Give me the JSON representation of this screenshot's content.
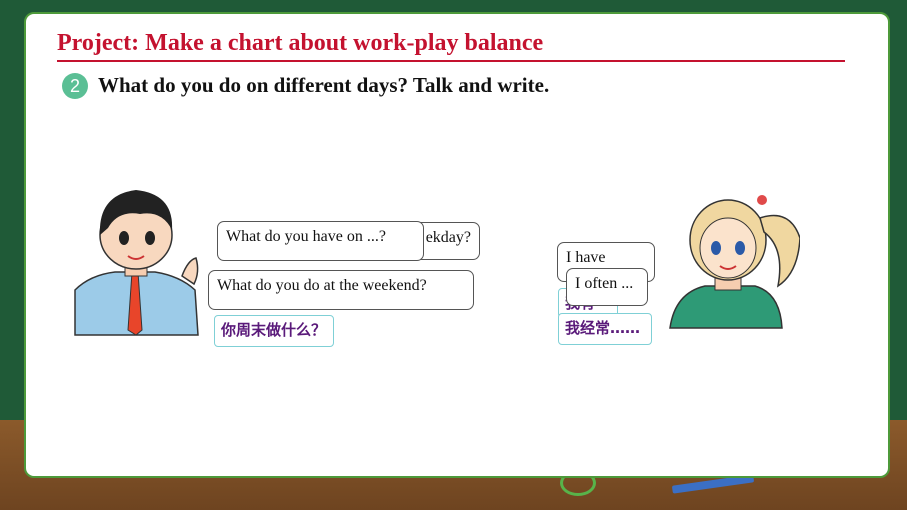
{
  "header": {
    "title": "Project: Make a chart about work-play balance",
    "step_number": "2",
    "instruction": "What do you do on different days? Talk and write."
  },
  "boy": {
    "bubble_back": "What do you have on ...?ekday?",
    "bubble_front": "What do you have on ...?",
    "bubble_back_tail": "ekday?",
    "bubble_weekend": "What do you do at the weekend?",
    "cn_weekend": "你周末做什么？"
  },
  "girl": {
    "bubble_back": "I have",
    "bubble_front": "I often ...",
    "cn_back": "我有",
    "cn_front": "我经常……"
  },
  "colors": {
    "title": "#c4122f",
    "board": "#1f5a37",
    "badge": "#5bbf95",
    "cn_text": "#5a1a7a"
  },
  "icons": [
    "boy-illustration",
    "girl-illustration",
    "pencil-icon",
    "scissors-icon"
  ]
}
